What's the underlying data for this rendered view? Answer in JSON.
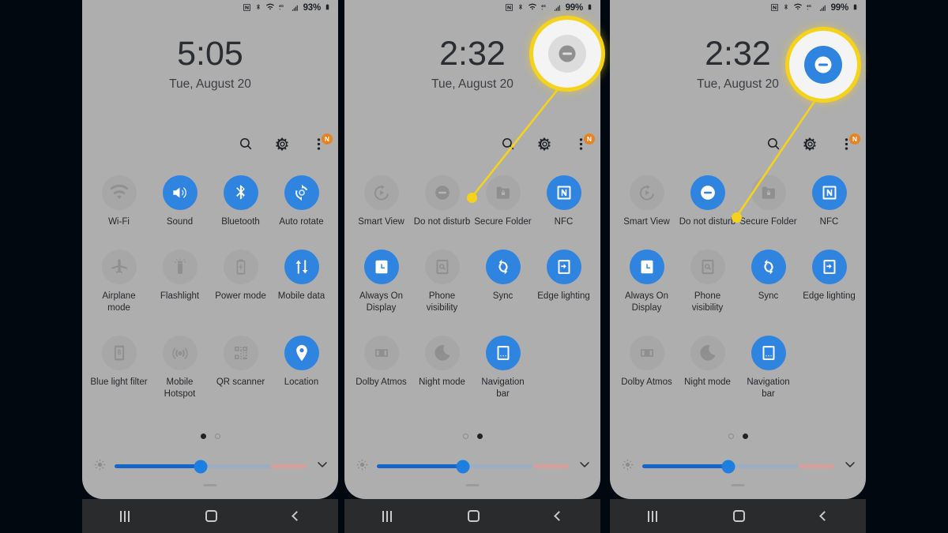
{
  "background_color": "#020810",
  "theme": {
    "panel_bg": "#aeaeae",
    "tile_on": "#2f84e0",
    "tile_off": "rgba(155,155,155,0.38)",
    "accent_highlight": "#f5d21c",
    "badge_orange": "#e8821e",
    "navbar_bg": "#2a2b2d",
    "slider_fill": "#1665c8",
    "slider_tail": "#d69e9c"
  },
  "panels": [
    {
      "id": "panel-1",
      "status_bar": {
        "icons": [
          "nfc-icon",
          "bluetooth-icon",
          "wifi-icon",
          "lte-plus-icon",
          "signal-bars-icon"
        ],
        "battery_percent": "93%",
        "battery_icon": "battery-full-icon"
      },
      "clock": {
        "time": "5:05",
        "date": "Tue, August 20"
      },
      "actions": [
        {
          "name": "search-icon",
          "label": "Search"
        },
        {
          "name": "gear-icon",
          "label": "Settings"
        },
        {
          "name": "more-options-icon",
          "label": "More options",
          "badge": "N"
        }
      ],
      "tiles": [
        {
          "label": "Wi-Fi",
          "icon": "wifi-icon",
          "state": "off"
        },
        {
          "label": "Sound",
          "icon": "volume-icon",
          "state": "on"
        },
        {
          "label": "Bluetooth",
          "icon": "bluetooth-icon",
          "state": "on"
        },
        {
          "label": "Auto rotate",
          "icon": "auto-rotate-icon",
          "state": "on"
        },
        {
          "label": "Airplane mode",
          "icon": "airplane-icon",
          "state": "off"
        },
        {
          "label": "Flashlight",
          "icon": "flashlight-icon",
          "state": "off"
        },
        {
          "label": "Power mode",
          "icon": "power-mode-icon",
          "state": "off"
        },
        {
          "label": "Mobile data",
          "icon": "mobile-data-icon",
          "state": "on"
        },
        {
          "label": "Blue light filter",
          "icon": "blue-light-icon",
          "state": "off"
        },
        {
          "label": "Mobile Hotspot",
          "icon": "hotspot-icon",
          "state": "off"
        },
        {
          "label": "QR scanner",
          "icon": "qr-scanner-icon",
          "state": "off"
        },
        {
          "label": "Location",
          "icon": "location-pin-icon",
          "state": "on"
        }
      ],
      "page_dots": [
        "filled",
        "hollow"
      ],
      "brightness": {
        "icon": "brightness-icon",
        "value_percent": 45,
        "expand_icon": "chevron-down-icon"
      },
      "nav_bar": {
        "recents": "recents-icon",
        "home": "home-icon",
        "back": "back-icon"
      },
      "callout": null
    },
    {
      "id": "panel-2",
      "status_bar": {
        "icons": [
          "nfc-icon",
          "bluetooth-icon",
          "wifi-icon",
          "lte-plus-icon",
          "signal-bars-icon"
        ],
        "battery_percent": "99%",
        "battery_icon": "battery-full-icon"
      },
      "clock": {
        "time": "2:32",
        "date": "Tue, August 20"
      },
      "actions": [
        {
          "name": "search-icon",
          "label": "Search"
        },
        {
          "name": "gear-icon",
          "label": "Settings"
        },
        {
          "name": "more-options-icon",
          "label": "More options",
          "badge": "N"
        }
      ],
      "tiles": [
        {
          "label": "Smart View",
          "icon": "smart-view-icon",
          "state": "off"
        },
        {
          "label": "Do not disturb",
          "icon": "do-not-disturb-icon",
          "state": "off"
        },
        {
          "label": "Secure Folder",
          "icon": "secure-folder-icon",
          "state": "off"
        },
        {
          "label": "NFC",
          "icon": "nfc-icon",
          "state": "on"
        },
        {
          "label": "Always On Display",
          "icon": "always-on-display-icon",
          "state": "on"
        },
        {
          "label": "Phone visibility",
          "icon": "phone-visibility-icon",
          "state": "off"
        },
        {
          "label": "Sync",
          "icon": "sync-icon",
          "state": "on"
        },
        {
          "label": "Edge lighting",
          "icon": "edge-lighting-icon",
          "state": "on"
        },
        {
          "label": "Dolby Atmos",
          "icon": "dolby-atmos-icon",
          "state": "off"
        },
        {
          "label": "Night mode",
          "icon": "night-mode-icon",
          "state": "off"
        },
        {
          "label": "Navigation bar",
          "icon": "navigation-bar-icon",
          "state": "on"
        }
      ],
      "page_dots": [
        "hollow",
        "filled"
      ],
      "brightness": {
        "icon": "brightness-icon",
        "value_percent": 45,
        "expand_icon": "chevron-down-icon"
      },
      "nav_bar": {
        "recents": "recents-icon",
        "home": "home-icon",
        "back": "back-icon"
      },
      "callout": {
        "icon": "do-not-disturb-icon",
        "state": "off",
        "target_tile": "Do not disturb"
      }
    },
    {
      "id": "panel-3",
      "status_bar": {
        "icons": [
          "nfc-icon",
          "bluetooth-icon",
          "wifi-icon",
          "lte-plus-icon",
          "signal-bars-icon"
        ],
        "battery_percent": "99%",
        "battery_icon": "battery-full-icon"
      },
      "clock": {
        "time": "2:32",
        "date": "Tue, August 20"
      },
      "actions": [
        {
          "name": "search-icon",
          "label": "Search"
        },
        {
          "name": "gear-icon",
          "label": "Settings"
        },
        {
          "name": "more-options-icon",
          "label": "More options",
          "badge": "N"
        }
      ],
      "tiles": [
        {
          "label": "Smart View",
          "icon": "smart-view-icon",
          "state": "off"
        },
        {
          "label": "Do not disturb",
          "icon": "do-not-disturb-icon",
          "state": "on"
        },
        {
          "label": "Secure Folder",
          "icon": "secure-folder-icon",
          "state": "off"
        },
        {
          "label": "NFC",
          "icon": "nfc-icon",
          "state": "on"
        },
        {
          "label": "Always On Display",
          "icon": "always-on-display-icon",
          "state": "on"
        },
        {
          "label": "Phone visibility",
          "icon": "phone-visibility-icon",
          "state": "off"
        },
        {
          "label": "Sync",
          "icon": "sync-icon",
          "state": "on"
        },
        {
          "label": "Edge lighting",
          "icon": "edge-lighting-icon",
          "state": "on"
        },
        {
          "label": "Dolby Atmos",
          "icon": "dolby-atmos-icon",
          "state": "off"
        },
        {
          "label": "Night mode",
          "icon": "night-mode-icon",
          "state": "off"
        },
        {
          "label": "Navigation bar",
          "icon": "navigation-bar-icon",
          "state": "on"
        }
      ],
      "page_dots": [
        "hollow",
        "filled"
      ],
      "brightness": {
        "icon": "brightness-icon",
        "value_percent": 45,
        "expand_icon": "chevron-down-icon"
      },
      "nav_bar": {
        "recents": "recents-icon",
        "home": "home-icon",
        "back": "back-icon"
      },
      "callout": {
        "icon": "do-not-disturb-icon",
        "state": "on",
        "target_tile": "Do not disturb"
      }
    }
  ]
}
